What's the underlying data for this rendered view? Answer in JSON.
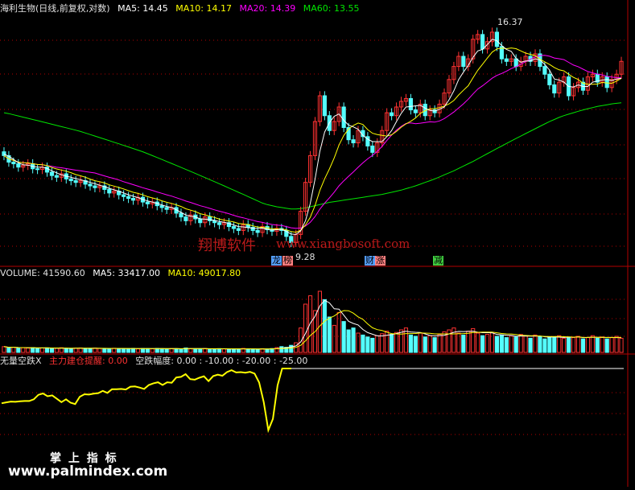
{
  "header": {
    "stock_name": "海利生物(日线,前复权,对数)",
    "ma5_label": "MA5: 14.45",
    "ma10_label": "MA10: 14.17",
    "ma20_label": "MA20: 14.39",
    "ma60_label": "MA60: 13.55"
  },
  "volume_header": {
    "volume_label": "VOLUME: 41590.60",
    "ma5_label": "MA5: 33417.00",
    "ma10_label": "MA10: 49017.80"
  },
  "indicator_header": {
    "name_label": "无量空跌X",
    "signal_label": "主力建仓提醒: 0.00",
    "drop_label": "空跌幅度: 0.00 : -10.00 : -20.00 : -25.00"
  },
  "annotations": {
    "high_price": "16.37",
    "low_price": "9.28",
    "tag_dragon": "龙",
    "tag_list": "榜",
    "tag_finance": "财",
    "tag_rise": "涨",
    "tag_reduce": "减"
  },
  "watermarks": {
    "brand_cn": "翔博软件",
    "brand_url": "www.xiangbosoft.com",
    "footer_cn": "掌 上 指 标",
    "footer_url": "www.palmindex.com"
  },
  "colors": {
    "background": "#000000",
    "up": "#ff3232",
    "down": "#54ffff",
    "ma5": "#ffffff",
    "ma10": "#ffff00",
    "ma20": "#ff00ff",
    "ma60": "#00e600",
    "indicator": "#ffff00",
    "grid": "#b40000"
  },
  "chart_data": [
    {
      "type": "candlestick",
      "title": "海利生物(日线,前复权,对数)",
      "scale": "log",
      "ylim": [
        9.0,
        17.0
      ],
      "x": [
        1,
        2,
        3,
        4,
        5,
        6,
        7,
        8,
        9,
        10,
        11,
        12,
        13,
        14,
        15,
        16,
        17,
        18,
        19,
        20,
        21,
        22,
        23,
        24,
        25,
        26,
        27,
        28,
        29,
        30,
        31,
        32,
        33,
        34,
        35,
        36,
        37,
        38,
        39,
        40,
        41,
        42,
        43,
        44,
        45,
        46,
        47,
        48,
        49,
        50,
        51,
        52,
        53,
        54,
        55,
        56,
        57,
        58,
        59,
        60,
        61,
        62,
        63,
        64,
        65,
        66,
        67,
        68,
        69,
        70,
        71,
        72,
        73,
        74,
        75,
        76,
        77,
        78,
        79,
        80,
        81,
        82,
        83,
        84,
        85,
        86,
        87,
        88,
        89,
        90,
        91,
        92,
        93,
        94,
        95,
        96,
        97,
        98,
        99,
        100,
        101,
        102,
        103,
        104,
        105,
        106,
        107,
        108,
        109,
        110,
        111,
        112,
        113,
        114,
        115,
        116,
        117,
        118,
        119,
        120,
        121,
        122,
        123,
        124,
        125,
        126,
        127,
        128,
        129,
        130
      ],
      "close": [
        11.8,
        11.6,
        11.55,
        11.45,
        11.5,
        11.55,
        11.4,
        11.38,
        11.45,
        11.3,
        11.2,
        11.15,
        11.25,
        11.1,
        11.05,
        11.0,
        11.05,
        10.95,
        10.9,
        10.85,
        10.9,
        10.8,
        10.7,
        10.75,
        10.65,
        10.6,
        10.55,
        10.5,
        10.58,
        10.45,
        10.4,
        10.45,
        10.35,
        10.3,
        10.25,
        10.3,
        10.15,
        10.05,
        9.95,
        10.1,
        10.0,
        9.9,
        10.05,
        9.95,
        9.9,
        9.85,
        9.9,
        9.8,
        9.75,
        9.7,
        9.85,
        9.78,
        9.7,
        9.65,
        9.8,
        9.72,
        9.68,
        9.75,
        9.7,
        9.55,
        9.4,
        9.6,
        10.2,
        11.0,
        11.8,
        12.9,
        13.8,
        13.1,
        12.6,
        12.9,
        13.4,
        12.7,
        12.3,
        12.2,
        12.6,
        12.4,
        12.1,
        11.9,
        12.2,
        12.6,
        13.2,
        13.1,
        13.4,
        13.6,
        13.7,
        13.3,
        13.2,
        13.5,
        13.1,
        13.3,
        13.2,
        13.5,
        13.9,
        14.4,
        14.9,
        15.3,
        14.9,
        15.2,
        16.0,
        16.2,
        15.6,
        15.9,
        16.3,
        15.7,
        15.2,
        15.1,
        15.2,
        14.9,
        15.1,
        15.3,
        15.1,
        15.4,
        14.9,
        14.6,
        14.2,
        13.9,
        14.3,
        14.5,
        13.8,
        14.1,
        14.3,
        14.0,
        14.5,
        14.6,
        14.3,
        14.5,
        14.1,
        14.4,
        14.6,
        15.1
      ],
      "ma5": [
        11.85,
        11.78,
        11.68,
        11.58,
        11.52,
        11.51,
        11.47,
        11.45,
        11.45,
        11.41,
        11.34,
        11.28,
        11.22,
        11.18,
        11.15,
        11.11,
        11.08,
        11.04,
        11.0,
        10.96,
        10.92,
        10.88,
        10.83,
        10.79,
        10.75,
        10.7,
        10.65,
        10.61,
        10.57,
        10.52,
        10.48,
        10.45,
        10.41,
        10.37,
        10.33,
        10.3,
        10.24,
        10.17,
        10.1,
        10.07,
        10.05,
        10.0,
        9.99,
        9.98,
        9.96,
        9.93,
        9.91,
        9.88,
        9.84,
        9.8,
        9.79,
        9.77,
        9.76,
        9.75,
        9.76,
        9.73,
        9.71,
        9.72,
        9.73,
        9.68,
        9.61,
        9.6,
        9.69,
        9.95,
        10.41,
        11.1,
        11.93,
        12.55,
        12.86,
        13.08,
        13.16,
        12.94,
        12.78,
        12.72,
        12.64,
        12.44,
        12.32,
        12.24,
        12.24,
        12.24,
        12.4,
        12.6,
        12.9,
        13.18,
        13.4,
        13.42,
        13.44,
        13.46,
        13.36,
        13.28,
        13.26,
        13.32,
        13.4,
        13.66,
        13.98,
        14.4,
        14.68,
        14.94,
        15.26,
        15.52,
        15.58,
        15.78,
        16.0,
        15.94,
        15.74,
        15.58,
        15.5,
        15.22,
        15.06,
        15.12,
        15.12,
        15.2,
        15.16,
        14.98,
        14.76,
        14.42,
        14.38,
        14.3,
        14.14,
        14.12,
        14.2,
        14.14,
        14.14,
        14.3,
        14.34,
        14.38,
        14.4,
        14.36,
        14.42,
        14.45
      ],
      "ma60": [
        13.2,
        13.17,
        13.13,
        13.09,
        13.05,
        13.01,
        12.97,
        12.93,
        12.89,
        12.85,
        12.81,
        12.77,
        12.73,
        12.69,
        12.65,
        12.61,
        12.57,
        12.52,
        12.47,
        12.42,
        12.37,
        12.32,
        12.27,
        12.22,
        12.17,
        12.12,
        12.07,
        12.02,
        11.97,
        11.92,
        11.86,
        11.8,
        11.74,
        11.68,
        11.62,
        11.56,
        11.5,
        11.44,
        11.38,
        11.32,
        11.26,
        11.2,
        11.14,
        11.08,
        11.02,
        10.96,
        10.9,
        10.84,
        10.78,
        10.72,
        10.66,
        10.6,
        10.54,
        10.48,
        10.42,
        10.38,
        10.35,
        10.32,
        10.3,
        10.28,
        10.26,
        10.26,
        10.27,
        10.29,
        10.32,
        10.35,
        10.38,
        10.41,
        10.44,
        10.46,
        10.48,
        10.5,
        10.52,
        10.54,
        10.56,
        10.58,
        10.6,
        10.62,
        10.64,
        10.66,
        10.69,
        10.72,
        10.75,
        10.78,
        10.82,
        10.86,
        10.9,
        10.95,
        11.0,
        11.05,
        11.1,
        11.16,
        11.22,
        11.28,
        11.34,
        11.41,
        11.48,
        11.55,
        11.62,
        11.7,
        11.78,
        11.86,
        11.94,
        12.02,
        12.1,
        12.18,
        12.26,
        12.34,
        12.42,
        12.5,
        12.58,
        12.66,
        12.74,
        12.82,
        12.9,
        12.97,
        13.04,
        13.1,
        13.15,
        13.2,
        13.25,
        13.3,
        13.34,
        13.38,
        13.42,
        13.45,
        13.48,
        13.51,
        13.53,
        13.55
      ],
      "annotations": {
        "high": 16.37,
        "low": 9.28
      }
    },
    {
      "type": "bar",
      "title": "VOLUME",
      "ylim": [
        0,
        110000
      ],
      "values": [
        9000,
        7000,
        8000,
        6500,
        7200,
        6800,
        7500,
        6200,
        6900,
        7100,
        5900,
        6400,
        7300,
        6100,
        5800,
        6600,
        7000,
        6300,
        5900,
        6800,
        6100,
        5700,
        6200,
        6500,
        5600,
        6000,
        5800,
        6300,
        5500,
        6100,
        5900,
        5600,
        6200,
        5800,
        5400,
        6000,
        5700,
        5500,
        6900,
        5800,
        5600,
        5300,
        6100,
        5500,
        5200,
        5800,
        5400,
        5100,
        5600,
        5300,
        6200,
        5400,
        5200,
        5000,
        5800,
        5300,
        6000,
        7500,
        9000,
        8000,
        11000,
        15000,
        38000,
        75000,
        88000,
        65000,
        95000,
        82000,
        55000,
        42000,
        62000,
        48000,
        35000,
        38000,
        30000,
        27000,
        24000,
        22000,
        26000,
        29000,
        33000,
        28000,
        31000,
        35000,
        38000,
        27000,
        25000,
        30000,
        24000,
        26000,
        23000,
        28000,
        32000,
        35000,
        38000,
        30000,
        27000,
        33000,
        37000,
        30000,
        26000,
        28000,
        31000,
        25000,
        27000,
        23000,
        26000,
        24000,
        28000,
        26000,
        22000,
        27000,
        25000,
        21000,
        24000,
        23000,
        26000,
        22000,
        24000,
        23000,
        25000,
        21000,
        23000,
        26000,
        22000,
        24000,
        21000,
        23000,
        25000,
        22000
      ],
      "up": [
        true,
        false,
        true,
        false,
        true,
        true,
        false,
        false,
        true,
        false,
        false,
        true,
        true,
        false,
        false,
        true,
        true,
        false,
        false,
        true,
        true,
        false,
        false,
        true,
        false,
        false,
        false,
        false,
        true,
        false,
        false,
        true,
        false,
        false,
        false,
        true,
        false,
        false,
        false,
        true,
        false,
        false,
        true,
        false,
        false,
        false,
        true,
        false,
        false,
        false,
        true,
        false,
        false,
        false,
        true,
        false,
        false,
        true,
        false,
        false,
        false,
        true,
        true,
        true,
        true,
        true,
        true,
        false,
        false,
        true,
        true,
        false,
        false,
        false,
        true,
        false,
        false,
        false,
        true,
        true,
        true,
        false,
        true,
        true,
        true,
        false,
        false,
        true,
        false,
        true,
        false,
        true,
        true,
        true,
        true,
        true,
        false,
        true,
        true,
        true,
        false,
        true,
        true,
        false,
        false,
        false,
        true,
        false,
        true,
        true,
        false,
        true,
        false,
        false,
        false,
        false,
        true,
        true,
        false,
        true,
        true,
        false,
        true,
        true,
        false,
        true,
        false,
        true,
        true,
        true
      ],
      "ma5_label": "MA5: 33417.00",
      "ma10_label": "MA10: 49017.80"
    },
    {
      "type": "line",
      "title": "无量空跌X",
      "ylim": [
        -25,
        0
      ],
      "reference_lines": [
        0,
        -10,
        -20,
        -25
      ],
      "values": [
        -12.4,
        -12.1,
        -11.8,
        -11.9,
        -11.7,
        -11.6,
        -11.6,
        -11.0,
        -9.4,
        -8.9,
        -9.9,
        -9.6,
        -10.8,
        -12.0,
        -11.0,
        -12.2,
        -12.7,
        -10.1,
        -9.2,
        -9.3,
        -9.0,
        -8.8,
        -8.0,
        -8.7,
        -7.4,
        -7.4,
        -7.3,
        -7.5,
        -6.5,
        -6.4,
        -6.8,
        -7.3,
        -5.9,
        -5.3,
        -4.9,
        -5.9,
        -4.9,
        -5.1,
        -3.2,
        -3.0,
        -2.0,
        -3.8,
        -4.0,
        -3.3,
        -2.8,
        -4.5,
        -2.7,
        -2.2,
        -2.6,
        -1.3,
        -0.6,
        -1.4,
        -1.3,
        -1.5,
        -1.2,
        -1.8,
        -5.0,
        -12.0,
        -22.0,
        -18.0,
        -6.0,
        0.0,
        0.0,
        0.0
      ]
    }
  ]
}
